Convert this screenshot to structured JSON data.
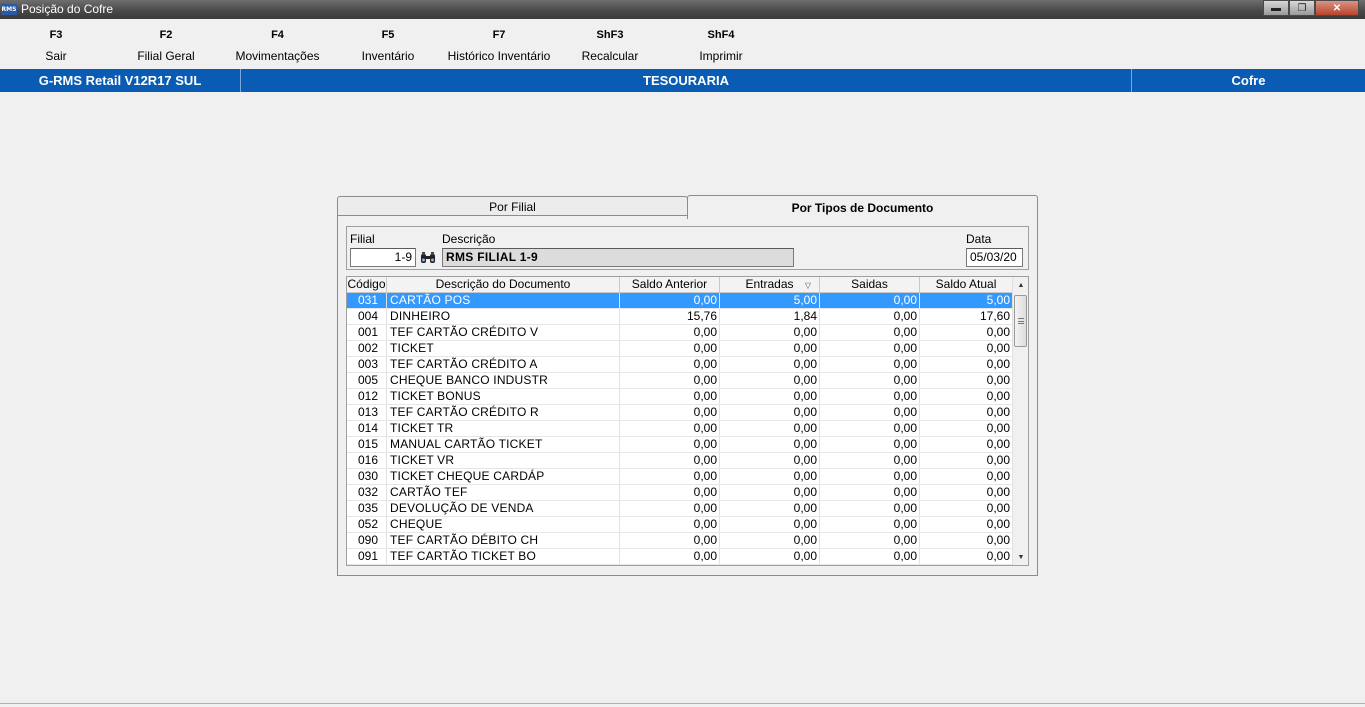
{
  "window": {
    "icon_text": "RMS",
    "title": "Posição do Cofre",
    "minimize_icon": "minimize-icon",
    "maximize_icon": "maximize-icon",
    "close_icon": "close-icon"
  },
  "toolbar": [
    {
      "key": "F3",
      "label": "Sair"
    },
    {
      "key": "F2",
      "label": "Filial Geral"
    },
    {
      "key": "F4",
      "label": "Movimentações"
    },
    {
      "key": "F5",
      "label": "Inventário"
    },
    {
      "key": "F7",
      "label": "Histórico Inventário"
    },
    {
      "key": "ShF3",
      "label": "Recalcular"
    },
    {
      "key": "ShF4",
      "label": "Imprimir"
    }
  ],
  "header_bar": {
    "left": "G-RMS Retail V12R17 SUL",
    "center": "TESOURARIA",
    "right": "Cofre",
    "color": "#0a5bb4"
  },
  "tabs": {
    "por_filial": "Por Filial",
    "por_tipos": "Por Tipos de Documento",
    "active": "por_tipos"
  },
  "form": {
    "filial_label": "Filial",
    "filial_value": "1-9",
    "descricao_label": "Descrição",
    "descricao_value": "RMS FILIAL 1-9",
    "data_label": "Data",
    "data_value": "05/03/20",
    "search_icon": "binoculars-icon"
  },
  "table": {
    "columns": [
      "Código",
      "Descrição do Documento",
      "Saldo Anterior",
      "Entradas",
      "Saidas",
      "Saldo Atual"
    ],
    "sorted_column": "Entradas",
    "sort_icon": "sort-desc-icon",
    "selected_row": 0,
    "selection_color": "#3399ff",
    "rows": [
      {
        "codigo": "031",
        "descricao": "CARTÃO POS",
        "saldo_anterior": "0,00",
        "entradas": "5,00",
        "saidas": "0,00",
        "saldo_atual": "5,00"
      },
      {
        "codigo": "004",
        "descricao": "DINHEIRO",
        "saldo_anterior": "15,76",
        "entradas": "1,84",
        "saidas": "0,00",
        "saldo_atual": "17,60"
      },
      {
        "codigo": "001",
        "descricao": "TEF CARTÃO CRÉDITO V",
        "saldo_anterior": "0,00",
        "entradas": "0,00",
        "saidas": "0,00",
        "saldo_atual": "0,00"
      },
      {
        "codigo": "002",
        "descricao": "TICKET",
        "saldo_anterior": "0,00",
        "entradas": "0,00",
        "saidas": "0,00",
        "saldo_atual": "0,00"
      },
      {
        "codigo": "003",
        "descricao": "TEF CARTÃO CRÉDITO A",
        "saldo_anterior": "0,00",
        "entradas": "0,00",
        "saidas": "0,00",
        "saldo_atual": "0,00"
      },
      {
        "codigo": "005",
        "descricao": "CHEQUE BANCO INDUSTR",
        "saldo_anterior": "0,00",
        "entradas": "0,00",
        "saidas": "0,00",
        "saldo_atual": "0,00"
      },
      {
        "codigo": "012",
        "descricao": "TICKET BONUS",
        "saldo_anterior": "0,00",
        "entradas": "0,00",
        "saidas": "0,00",
        "saldo_atual": "0,00"
      },
      {
        "codigo": "013",
        "descricao": "TEF CARTÃO CRÉDITO R",
        "saldo_anterior": "0,00",
        "entradas": "0,00",
        "saidas": "0,00",
        "saldo_atual": "0,00"
      },
      {
        "codigo": "014",
        "descricao": "TICKET TR",
        "saldo_anterior": "0,00",
        "entradas": "0,00",
        "saidas": "0,00",
        "saldo_atual": "0,00"
      },
      {
        "codigo": "015",
        "descricao": "MANUAL CARTÃO TICKET",
        "saldo_anterior": "0,00",
        "entradas": "0,00",
        "saidas": "0,00",
        "saldo_atual": "0,00"
      },
      {
        "codigo": "016",
        "descricao": "TICKET VR",
        "saldo_anterior": "0,00",
        "entradas": "0,00",
        "saidas": "0,00",
        "saldo_atual": "0,00"
      },
      {
        "codigo": "030",
        "descricao": "TICKET CHEQUE CARDÁP",
        "saldo_anterior": "0,00",
        "entradas": "0,00",
        "saidas": "0,00",
        "saldo_atual": "0,00"
      },
      {
        "codigo": "032",
        "descricao": "CARTÃO TEF",
        "saldo_anterior": "0,00",
        "entradas": "0,00",
        "saidas": "0,00",
        "saldo_atual": "0,00"
      },
      {
        "codigo": "035",
        "descricao": "DEVOLUÇÃO DE VENDA",
        "saldo_anterior": "0,00",
        "entradas": "0,00",
        "saidas": "0,00",
        "saldo_atual": "0,00"
      },
      {
        "codigo": "052",
        "descricao": "CHEQUE",
        "saldo_anterior": "0,00",
        "entradas": "0,00",
        "saidas": "0,00",
        "saldo_atual": "0,00"
      },
      {
        "codigo": "090",
        "descricao": "TEF CARTÃO DÉBITO CH",
        "saldo_anterior": "0,00",
        "entradas": "0,00",
        "saidas": "0,00",
        "saldo_atual": "0,00"
      },
      {
        "codigo": "091",
        "descricao": "TEF CARTÃO TICKET BO",
        "saldo_anterior": "0,00",
        "entradas": "0,00",
        "saidas": "0,00",
        "saldo_atual": "0,00"
      }
    ]
  }
}
